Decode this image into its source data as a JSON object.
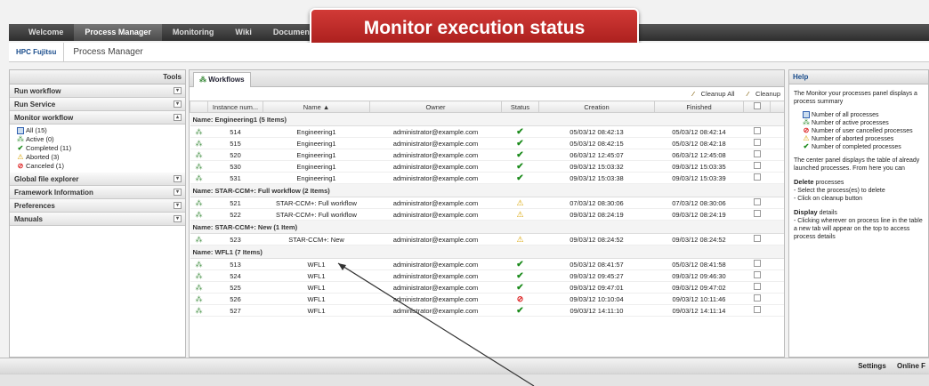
{
  "nav": {
    "items": [
      "Welcome",
      "Process Manager",
      "Monitoring",
      "Wiki",
      "Document"
    ],
    "active": "Process Manager"
  },
  "banner": "Monitor execution status",
  "breadcrumb": {
    "root": "HPC Fujitsu",
    "current": "Process Manager"
  },
  "tools": {
    "title": "Tools",
    "sections": [
      "Run workflow",
      "Run Service",
      "Monitor workflow",
      "Global file explorer",
      "Framework Information",
      "Preferences",
      "Manuals"
    ],
    "monitor": [
      {
        "icon": "all-icon",
        "label": "All (15)"
      },
      {
        "icon": "active-icon",
        "label": "Active (0)"
      },
      {
        "icon": "completed-icon",
        "label": "Completed (11)"
      },
      {
        "icon": "aborted-icon",
        "label": "Aborted (3)"
      },
      {
        "icon": "canceled-icon",
        "label": "Canceled (1)"
      }
    ]
  },
  "workflows": {
    "tab": "Workflows",
    "cleanup_all": "Cleanup All",
    "cleanup": "Cleanup",
    "columns": [
      "Instance num...",
      "Name ▲",
      "Owner",
      "Status",
      "Creation",
      "Finished"
    ],
    "groups": [
      {
        "title": "Name: Engineering1 (5 Items)",
        "rows": [
          [
            "514",
            "Engineering1",
            "administrator@example.com",
            "ok",
            "05/03/12 08:42:13",
            "05/03/12 08:42:14"
          ],
          [
            "515",
            "Engineering1",
            "administrator@example.com",
            "ok",
            "05/03/12 08:42:15",
            "05/03/12 08:42:18"
          ],
          [
            "520",
            "Engineering1",
            "administrator@example.com",
            "ok",
            "06/03/12 12:45:07",
            "06/03/12 12:45:08"
          ],
          [
            "530",
            "Engineering1",
            "administrator@example.com",
            "ok",
            "09/03/12 15:03:32",
            "09/03/12 15:03:35"
          ],
          [
            "531",
            "Engineering1",
            "administrator@example.com",
            "ok",
            "09/03/12 15:03:38",
            "09/03/12 15:03:39"
          ]
        ]
      },
      {
        "title": "Name: STAR-CCM+: Full workflow (2 Items)",
        "rows": [
          [
            "521",
            "STAR-CCM+: Full workflow",
            "administrator@example.com",
            "warn",
            "07/03/12 08:30:06",
            "07/03/12 08:30:06"
          ],
          [
            "522",
            "STAR-CCM+: Full workflow",
            "administrator@example.com",
            "warn",
            "09/03/12 08:24:19",
            "09/03/12 08:24:19"
          ]
        ]
      },
      {
        "title": "Name: STAR-CCM+: New (1 Item)",
        "rows": [
          [
            "523",
            "STAR-CCM+: New",
            "administrator@example.com",
            "warn",
            "09/03/12 08:24:52",
            "09/03/12 08:24:52"
          ]
        ]
      },
      {
        "title": "Name: WFL1 (7 Items)",
        "rows": [
          [
            "513",
            "WFL1",
            "administrator@example.com",
            "ok",
            "05/03/12 08:41:57",
            "05/03/12 08:41:58"
          ],
          [
            "524",
            "WFL1",
            "administrator@example.com",
            "ok",
            "09/03/12 09:45:27",
            "09/03/12 09:46:30"
          ],
          [
            "525",
            "WFL1",
            "administrator@example.com",
            "ok",
            "09/03/12 09:47:01",
            "09/03/12 09:47:02"
          ],
          [
            "526",
            "WFL1",
            "administrator@example.com",
            "cancel",
            "09/03/12 10:10:04",
            "09/03/12 10:11:46"
          ],
          [
            "527",
            "WFL1",
            "administrator@example.com",
            "ok",
            "09/03/12 14:11:10",
            "09/03/12 14:11:14"
          ]
        ]
      }
    ]
  },
  "help": {
    "title": "Help",
    "intro": "The Monitor your processes panel displays a process summary",
    "legend": [
      "Number of all processes",
      "Number of active processes",
      "Number of user cancelled processes",
      "Number of aborted processes",
      "Number of completed processes"
    ],
    "p2": "The center panel displays the table of already launched processes. From here you can",
    "delete_h": "Delete",
    "delete_h2": " processes",
    "delete1": "- Select the process(es)  to delete",
    "delete2": "- Click on cleanup  button",
    "display_h": "Display",
    "display_h2": " details",
    "display1": "- Clicking wherever on process line in the table a new tab will appear on the top to access process details"
  },
  "statusbar": {
    "settings": "Settings",
    "online": "Online F"
  }
}
